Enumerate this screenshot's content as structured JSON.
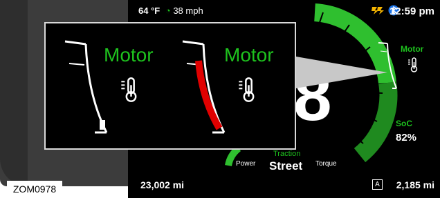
{
  "figure_ref": "ZOM0978",
  "status_bar": {
    "temperature": "64 °F",
    "speed": "38 mph",
    "time": "12:59 pm"
  },
  "motor_gauge": {
    "label": "Motor",
    "level": 0.8
  },
  "popup": {
    "left_label": "Motor",
    "left_level": 0.15,
    "right_label": "Motor",
    "right_level": 0.85
  },
  "battery": {
    "soc_label": "SoC",
    "soc_value": "82%"
  },
  "speedometer": {
    "digit": "8"
  },
  "ride_mode": {
    "power": "Power",
    "traction": "Traction",
    "street": "Street",
    "torque": "Torque"
  },
  "bottom_bar": {
    "odometer": "23,002 mi",
    "range_mode": "A",
    "range": "2,185 mi"
  },
  "icons": {
    "cruise": "cruise-control-icon",
    "lightning": "charging-icon",
    "bluetooth": "bluetooth-icon",
    "thermometer": "thermometer-icon"
  },
  "colors": {
    "accent_green": "#1ec21e",
    "warning_red": "#e00000",
    "arc_green": "#2fbf2f",
    "arc_dark_green": "#1f8a1f"
  }
}
